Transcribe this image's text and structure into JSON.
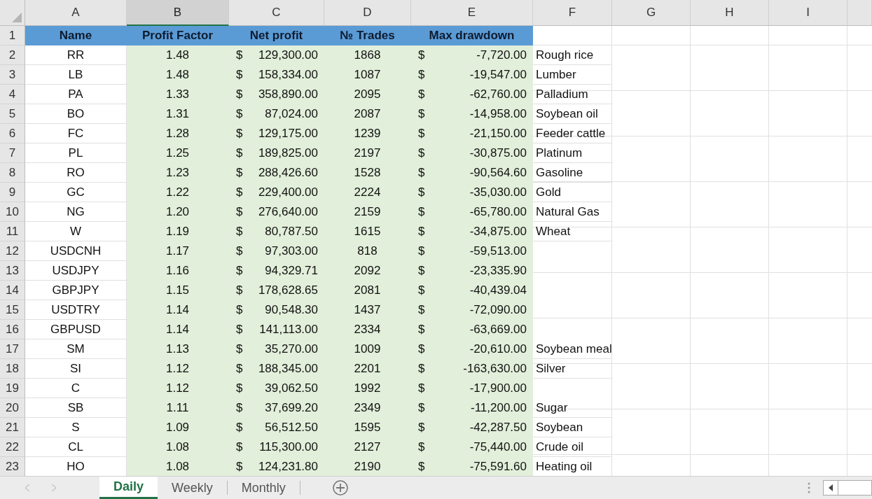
{
  "columns": [
    {
      "label": "A",
      "selected": false
    },
    {
      "label": "B",
      "selected": true
    },
    {
      "label": "C",
      "selected": false
    },
    {
      "label": "D",
      "selected": false
    },
    {
      "label": "E",
      "selected": false
    },
    {
      "label": "F",
      "selected": false
    },
    {
      "label": "G",
      "selected": false
    },
    {
      "label": "H",
      "selected": false
    },
    {
      "label": "I",
      "selected": false
    }
  ],
  "header_row": {
    "row_number": "1",
    "cells": [
      "Name",
      "Profit Factor",
      "Net profit",
      "№ Trades",
      "Max drawdown"
    ]
  },
  "rows": [
    {
      "row_number": "2",
      "name": "RR",
      "profit_factor": "1.48",
      "net_profit_currency": "$",
      "net_profit": "129,300.00",
      "trades": "1868",
      "drawdown_currency": "$",
      "max_drawdown": "-7,720.00",
      "note": "Rough rice"
    },
    {
      "row_number": "3",
      "name": "LB",
      "profit_factor": "1.48",
      "net_profit_currency": "$",
      "net_profit": "158,334.00",
      "trades": "1087",
      "drawdown_currency": "$",
      "max_drawdown": "-19,547.00",
      "note": "Lumber"
    },
    {
      "row_number": "4",
      "name": "PA",
      "profit_factor": "1.33",
      "net_profit_currency": "$",
      "net_profit": "358,890.00",
      "trades": "2095",
      "drawdown_currency": "$",
      "max_drawdown": "-62,760.00",
      "note": "Palladium"
    },
    {
      "row_number": "5",
      "name": "BO",
      "profit_factor": "1.31",
      "net_profit_currency": "$",
      "net_profit": "87,024.00",
      "trades": "2087",
      "drawdown_currency": "$",
      "max_drawdown": "-14,958.00",
      "note": "Soybean oil"
    },
    {
      "row_number": "6",
      "name": "FC",
      "profit_factor": "1.28",
      "net_profit_currency": "$",
      "net_profit": "129,175.00",
      "trades": "1239",
      "drawdown_currency": "$",
      "max_drawdown": "-21,150.00",
      "note": "Feeder cattle"
    },
    {
      "row_number": "7",
      "name": "PL",
      "profit_factor": "1.25",
      "net_profit_currency": "$",
      "net_profit": "189,825.00",
      "trades": "2197",
      "drawdown_currency": "$",
      "max_drawdown": "-30,875.00",
      "note": "Platinum"
    },
    {
      "row_number": "8",
      "name": "RO",
      "profit_factor": "1.23",
      "net_profit_currency": "$",
      "net_profit": "288,426.60",
      "trades": "1528",
      "drawdown_currency": "$",
      "max_drawdown": "-90,564.60",
      "note": "Gasoline"
    },
    {
      "row_number": "9",
      "name": "GC",
      "profit_factor": "1.22",
      "net_profit_currency": "$",
      "net_profit": "229,400.00",
      "trades": "2224",
      "drawdown_currency": "$",
      "max_drawdown": "-35,030.00",
      "note": "Gold"
    },
    {
      "row_number": "10",
      "name": "NG",
      "profit_factor": "1.20",
      "net_profit_currency": "$",
      "net_profit": "276,640.00",
      "trades": "2159",
      "drawdown_currency": "$",
      "max_drawdown": "-65,780.00",
      "note": "Natural Gas"
    },
    {
      "row_number": "11",
      "name": "W",
      "profit_factor": "1.19",
      "net_profit_currency": "$",
      "net_profit": "80,787.50",
      "trades": "1615",
      "drawdown_currency": "$",
      "max_drawdown": "-34,875.00",
      "note": "Wheat"
    },
    {
      "row_number": "12",
      "name": "USDCNH",
      "profit_factor": "1.17",
      "net_profit_currency": "$",
      "net_profit": "97,303.00",
      "trades": "818",
      "drawdown_currency": "$",
      "max_drawdown": "-59,513.00"
    },
    {
      "row_number": "13",
      "name": "USDJPY",
      "profit_factor": "1.16",
      "net_profit_currency": "$",
      "net_profit": "94,329.71",
      "trades": "2092",
      "drawdown_currency": "$",
      "max_drawdown": "-23,335.90"
    },
    {
      "row_number": "14",
      "name": "GBPJPY",
      "profit_factor": "1.15",
      "net_profit_currency": "$",
      "net_profit": "178,628.65",
      "trades": "2081",
      "drawdown_currency": "$",
      "max_drawdown": "-40,439.04"
    },
    {
      "row_number": "15",
      "name": "USDTRY",
      "profit_factor": "1.14",
      "net_profit_currency": "$",
      "net_profit": "90,548.30",
      "trades": "1437",
      "drawdown_currency": "$",
      "max_drawdown": "-72,090.00"
    },
    {
      "row_number": "16",
      "name": "GBPUSD",
      "profit_factor": "1.14",
      "net_profit_currency": "$",
      "net_profit": "141,113.00",
      "trades": "2334",
      "drawdown_currency": "$",
      "max_drawdown": "-63,669.00"
    },
    {
      "row_number": "17",
      "name": "SM",
      "profit_factor": "1.13",
      "net_profit_currency": "$",
      "net_profit": "35,270.00",
      "trades": "1009",
      "drawdown_currency": "$",
      "max_drawdown": "-20,610.00",
      "note": "Soybean meal"
    },
    {
      "row_number": "18",
      "name": "SI",
      "profit_factor": "1.12",
      "net_profit_currency": "$",
      "net_profit": "188,345.00",
      "trades": "2201",
      "drawdown_currency": "$",
      "max_drawdown": "-163,630.00",
      "note": "Silver"
    },
    {
      "row_number": "19",
      "name": "C",
      "profit_factor": "1.12",
      "net_profit_currency": "$",
      "net_profit": "39,062.50",
      "trades": "1992",
      "drawdown_currency": "$",
      "max_drawdown": "-17,900.00"
    },
    {
      "row_number": "20",
      "name": "SB",
      "profit_factor": "1.11",
      "net_profit_currency": "$",
      "net_profit": "37,699.20",
      "trades": "2349",
      "drawdown_currency": "$",
      "max_drawdown": "-11,200.00",
      "note": "Sugar"
    },
    {
      "row_number": "21",
      "name": "S",
      "profit_factor": "1.09",
      "net_profit_currency": "$",
      "net_profit": "56,512.50",
      "trades": "1595",
      "drawdown_currency": "$",
      "max_drawdown": "-42,287.50",
      "note": "Soybean"
    },
    {
      "row_number": "22",
      "name": "CL",
      "profit_factor": "1.08",
      "net_profit_currency": "$",
      "net_profit": "115,300.00",
      "trades": "2127",
      "drawdown_currency": "$",
      "max_drawdown": "-75,440.00",
      "note": "Crude oil"
    },
    {
      "row_number": "23",
      "name": "HO",
      "profit_factor": "1.08",
      "net_profit_currency": "$",
      "net_profit": "124,231.80",
      "trades": "2190",
      "drawdown_currency": "$",
      "max_drawdown": "-75,591.60",
      "note": "Heating oil"
    }
  ],
  "sheet_tabs": [
    {
      "label": "Daily",
      "selected": true
    },
    {
      "label": "Weekly",
      "selected": false
    },
    {
      "label": "Monthly",
      "selected": false
    }
  ]
}
